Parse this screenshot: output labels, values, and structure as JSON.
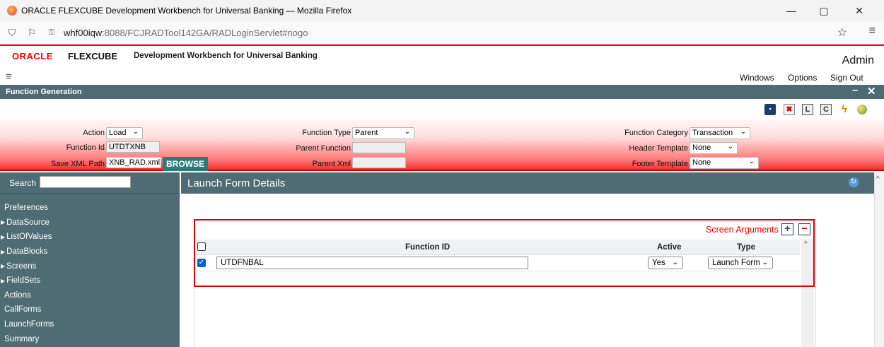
{
  "browser": {
    "window_title": "ORACLE FLEXCUBE Development Workbench for Universal Banking — Mozilla Firefox",
    "url_host": "whf00iqw",
    "url_path": ":8088/FCJRADTool142GA/RADLoginServlet#nogo",
    "controls": {
      "minimize": "—",
      "maximize": "▢",
      "close": "✕"
    }
  },
  "app_header": {
    "oracle_logo": "ORACLE",
    "product": "FLEXCUBE",
    "subtitle": "Development Workbench for Universal Banking",
    "user": "Admin"
  },
  "menu": {
    "items": [
      "Windows",
      "Options",
      "Sign Out"
    ]
  },
  "window": {
    "title": "Function Generation",
    "minimize": "–",
    "close": "✕"
  },
  "toolbar": {
    "buttons": [
      {
        "name": "save-icon",
        "glyph": "💾"
      },
      {
        "name": "delete-icon",
        "glyph": "✖"
      },
      {
        "name": "l-icon",
        "glyph": "L"
      },
      {
        "name": "c-icon",
        "glyph": "C"
      },
      {
        "name": "lightning-icon",
        "glyph": "⚡"
      },
      {
        "name": "globe-icon",
        "glyph": "🌐"
      }
    ]
  },
  "form": {
    "action_label": "Action",
    "action_value": "Load",
    "function_id_label": "Function Id",
    "function_id_value": "UTDTXNB",
    "save_xml_path_label": "Save XML Path",
    "save_xml_path_value": "XNB_RAD.xml",
    "browse_label": "BROWSE",
    "function_type_label": "Function Type",
    "function_type_value": "Parent",
    "parent_function_label": "Parent Function",
    "parent_function_value": "",
    "parent_xml_label": "Parent Xml",
    "parent_xml_value": "",
    "function_category_label": "Function Category",
    "function_category_value": "Transaction",
    "header_template_label": "Header Template",
    "header_template_value": "None",
    "footer_template_label": "Footer Template",
    "footer_template_value": "None"
  },
  "sidebar": {
    "search_label": "Search",
    "search_value": "",
    "items": [
      {
        "label": "Preferences",
        "expandable": false
      },
      {
        "label": "DataSource",
        "expandable": true
      },
      {
        "label": "ListOfValues",
        "expandable": true
      },
      {
        "label": "DataBlocks",
        "expandable": true
      },
      {
        "label": "Screens",
        "expandable": true
      },
      {
        "label": "FieldSets",
        "expandable": true
      },
      {
        "label": "Actions",
        "expandable": false
      },
      {
        "label": "CallForms",
        "expandable": false
      },
      {
        "label": "LaunchForms",
        "expandable": false
      },
      {
        "label": "Summary",
        "expandable": false
      }
    ]
  },
  "main": {
    "title": "Launch Form Details",
    "screen_arguments_label": "Screen Arguments",
    "add_glyph": "+",
    "remove_glyph": "−",
    "table": {
      "columns": [
        "Function ID",
        "Active",
        "Type"
      ],
      "rows": [
        {
          "checked": true,
          "function_id": "UTDFNBAL",
          "active": "Yes",
          "type": "Launch Form"
        }
      ]
    }
  }
}
